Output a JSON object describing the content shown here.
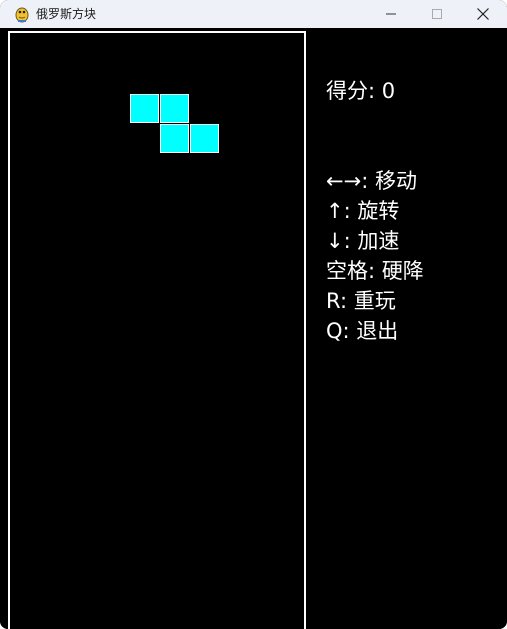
{
  "window": {
    "title": "俄罗斯方块",
    "icon": "pygame-snake-icon",
    "controls": {
      "minimize_icon": "minimize-icon",
      "maximize_icon": "maximize-icon",
      "close_icon": "close-icon"
    }
  },
  "game": {
    "board": {
      "columns": 10,
      "background": "#000000",
      "border_color": "#ffffff"
    },
    "active_piece": {
      "type": "Z",
      "color": "#00ffff",
      "cells": [
        {
          "col": 4,
          "row": 2
        },
        {
          "col": 5,
          "row": 2
        },
        {
          "col": 5,
          "row": 3
        },
        {
          "col": 6,
          "row": 3
        }
      ]
    },
    "score": {
      "label": "得分",
      "separator": ": ",
      "value": "0"
    },
    "help": [
      {
        "key": "←→",
        "separator": ": ",
        "action": "移动"
      },
      {
        "key": "↑",
        "separator": ": ",
        "action": "旋转"
      },
      {
        "key": "↓",
        "separator": ": ",
        "action": "加速"
      },
      {
        "key": "空格",
        "separator": ": ",
        "action": "硬降"
      },
      {
        "key": "R",
        "separator": ": ",
        "action": "重玩"
      },
      {
        "key": "Q",
        "separator": ": ",
        "action": "退出"
      }
    ]
  }
}
